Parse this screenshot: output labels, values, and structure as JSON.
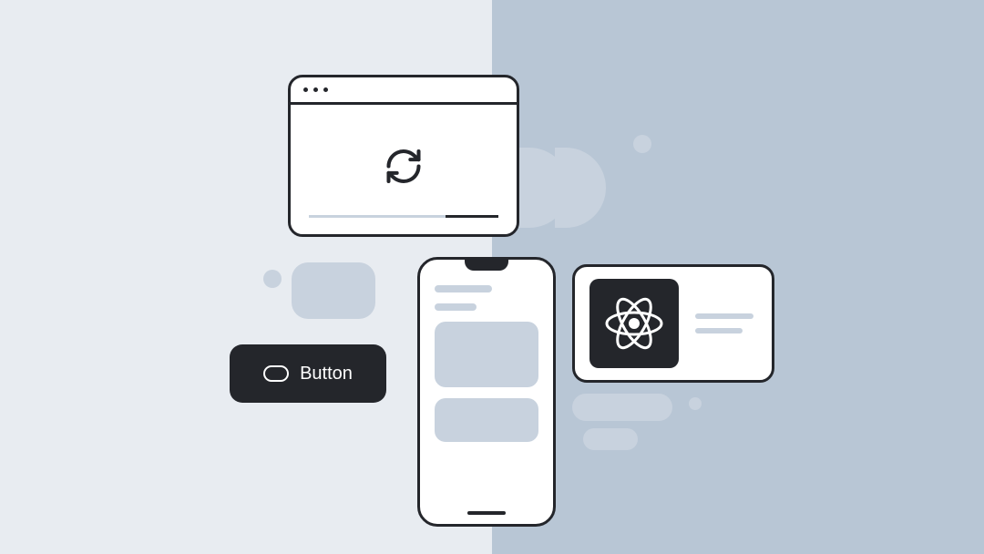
{
  "colors": {
    "bg_left": "#E8ECF1",
    "bg_right": "#B8C6D5",
    "ink": "#24262B",
    "placeholder": "#C8D2DE",
    "white": "#FFFFFF"
  },
  "button": {
    "label": "Button"
  },
  "icons": {
    "refresh": "refresh-icon",
    "react": "react-logo-icon",
    "toggle": "toggle-icon"
  }
}
